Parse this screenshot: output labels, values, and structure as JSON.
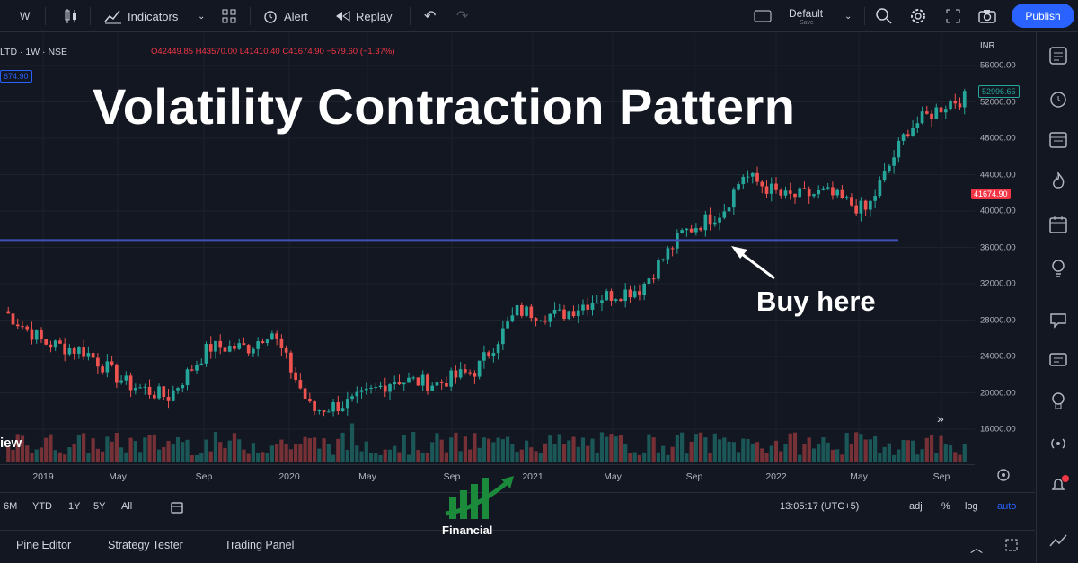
{
  "toolbar": {
    "symbol_short": "W",
    "indicators_label": "Indicators",
    "alert_label": "Alert",
    "replay_label": "Replay",
    "layout_label": "Default",
    "layout_sub": "Save",
    "publish_label": "Publish"
  },
  "legend": {
    "symbol": "LTD · 1W · NSE",
    "ohlc": "O42449.85 H43570.00 L41410.40 C41674.90 −579.60 (−1.37%)",
    "left_tag": "674.90"
  },
  "overlay": {
    "title": "Volatility Contraction Pattern",
    "annotation": "Buy here"
  },
  "price_axis": {
    "currency": "INR",
    "ticks": [
      "56000.00",
      "52000.00",
      "48000.00",
      "44000.00",
      "40000.00",
      "36000.00",
      "32000.00",
      "28000.00",
      "24000.00",
      "20000.00",
      "16000.00"
    ],
    "last_high_tag": "52996.65",
    "last_price_tag": "41674.90"
  },
  "time_axis": {
    "ticks": [
      "2019",
      "May",
      "Sep",
      "2020",
      "May",
      "Sep",
      "2021",
      "May",
      "Sep",
      "2022",
      "May",
      "Sep"
    ]
  },
  "ranges": [
    "6M",
    "YTD",
    "1Y",
    "5Y",
    "All"
  ],
  "clock": "13:05:17 (UTC+5)",
  "scale_opts": {
    "adj": "adj",
    "pct": "%",
    "log": "log",
    "auto": "auto"
  },
  "bottom_tabs": [
    "Pine Editor",
    "Strategy Tester",
    "Trading Panel"
  ],
  "watermark": {
    "name": "Financial"
  },
  "side_label": "iew",
  "colors": {
    "up": "#26a69a",
    "down": "#ef5350",
    "line": "#3f51b5",
    "accent": "#2962ff",
    "bg": "#131722"
  },
  "chart_data": {
    "type": "candlestick",
    "title": "Volatility Contraction Pattern",
    "y_range": [
      14000,
      58000
    ],
    "breakout_level": 36800,
    "annotation": {
      "label": "Buy here",
      "x": "2021-10",
      "y": 36800
    },
    "series_close_approx": [
      {
        "x": "2019-01",
        "y": 29000
      },
      {
        "x": "2019-03",
        "y": 25500
      },
      {
        "x": "2019-05",
        "y": 24500
      },
      {
        "x": "2019-07",
        "y": 21000
      },
      {
        "x": "2019-09",
        "y": 19500
      },
      {
        "x": "2019-11",
        "y": 25000
      },
      {
        "x": "2020-01",
        "y": 25000
      },
      {
        "x": "2020-02",
        "y": 27000
      },
      {
        "x": "2020-04",
        "y": 18000
      },
      {
        "x": "2020-06",
        "y": 19000
      },
      {
        "x": "2020-08",
        "y": 21500
      },
      {
        "x": "2020-10",
        "y": 21000
      },
      {
        "x": "2020-12",
        "y": 22500
      },
      {
        "x": "2021-02",
        "y": 29000
      },
      {
        "x": "2021-04",
        "y": 28500
      },
      {
        "x": "2021-06",
        "y": 30500
      },
      {
        "x": "2021-08",
        "y": 31500
      },
      {
        "x": "2021-10",
        "y": 37500
      },
      {
        "x": "2021-12",
        "y": 40000
      },
      {
        "x": "2022-01",
        "y": 44000
      },
      {
        "x": "2022-03",
        "y": 41500
      },
      {
        "x": "2022-05",
        "y": 42000
      },
      {
        "x": "2022-07",
        "y": 40000
      },
      {
        "x": "2022-09",
        "y": 49000
      },
      {
        "x": "2022-11",
        "y": 52000
      }
    ]
  }
}
